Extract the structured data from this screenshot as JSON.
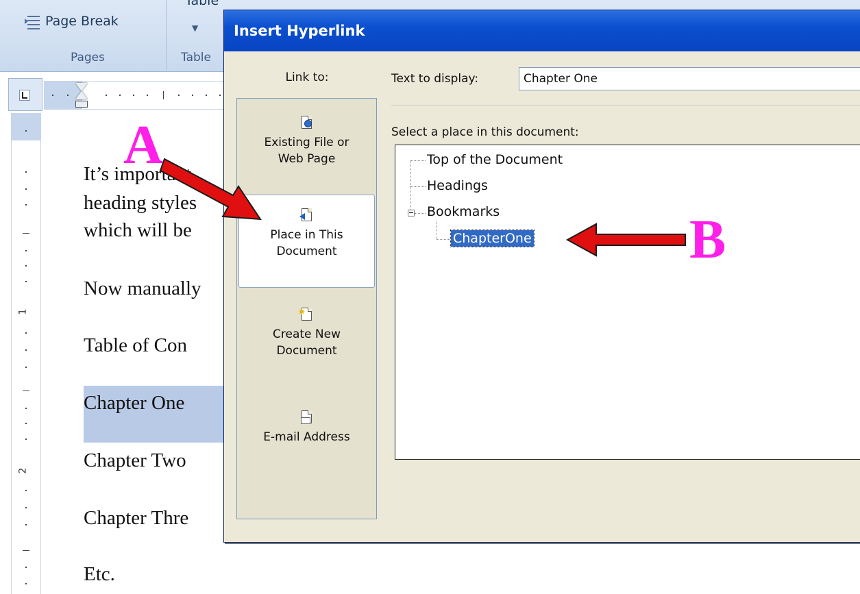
{
  "ribbon": {
    "page_break_label": "Page Break",
    "pages_group_label": "Pages",
    "table_button_label": "Table",
    "table_group_label": "Table"
  },
  "ruler": {
    "vertical_numbers": [
      "1",
      "2"
    ]
  },
  "document": {
    "lines": [
      "It’s important",
      "heading styles",
      "which will be",
      "Now manually",
      "Table of Con",
      "Chapter One",
      "Chapter Two",
      "Chapter Thre",
      "Etc."
    ],
    "selected_line": "Chapter One"
  },
  "dialog": {
    "title": "Insert Hyperlink",
    "link_to_label": "Link to:",
    "link_options": [
      {
        "label_line1": "Existing File or",
        "label_line2": "Web Page",
        "icon": "existing-file-icon",
        "selected": false
      },
      {
        "label_line1": "Place in This",
        "label_line2": "Document",
        "icon": "place-in-document-icon",
        "selected": true
      },
      {
        "label_line1": "Create New",
        "label_line2": "Document",
        "icon": "new-document-icon",
        "selected": false
      },
      {
        "label_line1": "E-mail Address",
        "label_line2": "",
        "icon": "email-icon",
        "selected": false
      }
    ],
    "text_to_display_label": "Text to display:",
    "text_to_display_value": "Chapter One",
    "select_place_label": "Select a place in this document:",
    "tree": {
      "top_of_document": "Top of the Document",
      "headings": "Headings",
      "bookmarks": "Bookmarks",
      "bookmark_selected": "ChapterOne"
    }
  },
  "annotations": {
    "a": "A",
    "b": "B",
    "arrow_color": "#e01010",
    "letter_color": "#ff1fe8"
  }
}
